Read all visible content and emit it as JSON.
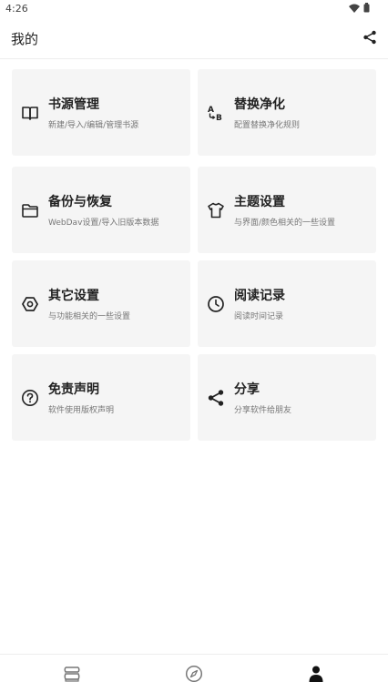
{
  "status_bar": {
    "time": "4:26",
    "icons": [
      "wifi-icon",
      "battery-icon"
    ]
  },
  "app_bar": {
    "title": "我的",
    "share_icon": "share-icon"
  },
  "cards": [
    {
      "title": "书源管理",
      "desc": "新建/导入/编辑/管理书源",
      "icon": "book-icon"
    },
    {
      "title": "替换净化",
      "desc": "配置替换净化规则",
      "icon": "replace-ab-icon"
    },
    {
      "title": "备份与恢复",
      "desc": "WebDav设置/导入旧版本数据",
      "icon": "folder-icon"
    },
    {
      "title": "主题设置",
      "desc": "与界面/颜色相关的一些设置",
      "icon": "tshirt-icon"
    },
    {
      "title": "其它设置",
      "desc": "与功能相关的一些设置",
      "icon": "hexagon-settings-icon"
    },
    {
      "title": "阅读记录",
      "desc": "阅读时间记录",
      "icon": "clock-icon"
    },
    {
      "title": "免责声明",
      "desc": "软件使用版权声明",
      "icon": "help-circle-icon"
    },
    {
      "title": "分享",
      "desc": "分享软件给朋友",
      "icon": "share-icon"
    }
  ],
  "bottom_nav": {
    "items": [
      {
        "icon": "bookshelf-icon",
        "active": false
      },
      {
        "icon": "compass-icon",
        "active": false
      },
      {
        "icon": "person-icon",
        "active": true
      }
    ],
    "active_color": "#111111",
    "inactive_color": "#777777"
  }
}
